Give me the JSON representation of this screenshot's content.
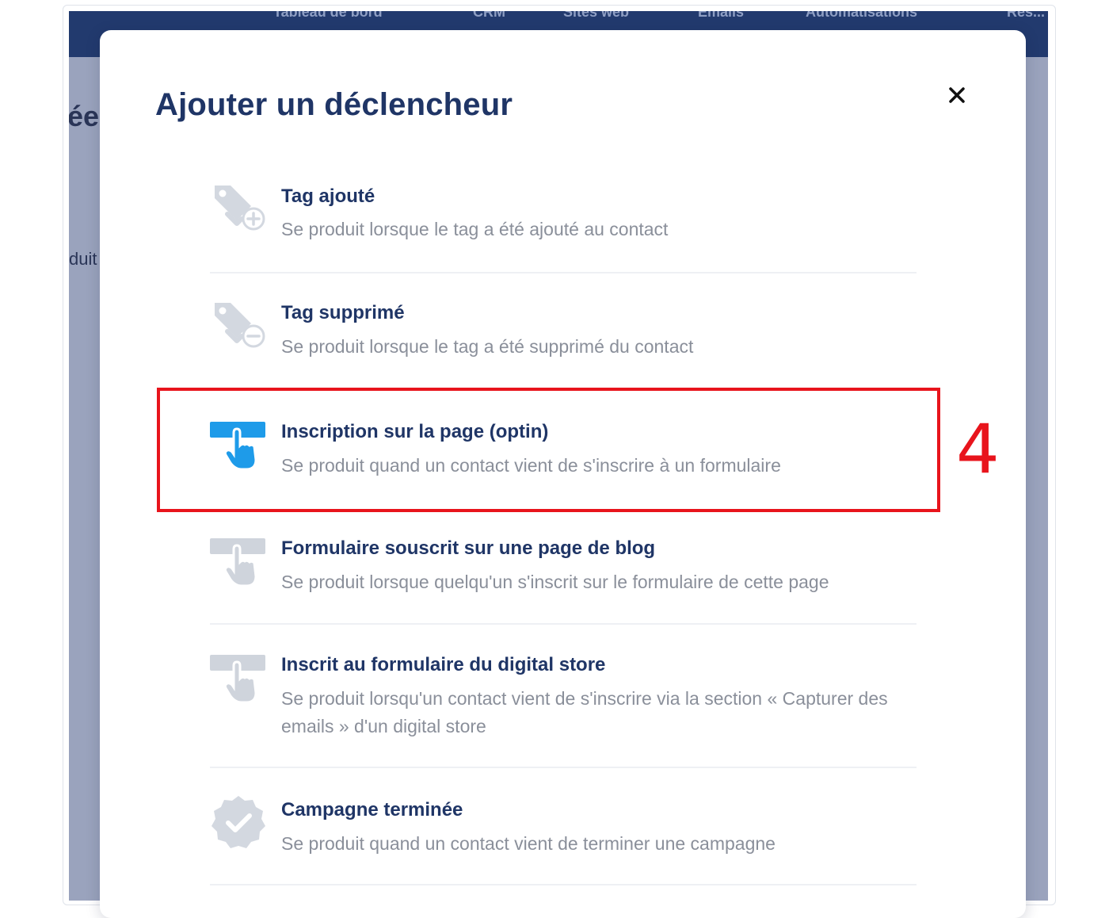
{
  "background_app": {
    "nav_items": [
      "Tableau de bord",
      "CRM",
      "Sites web",
      "Emails",
      "Automatisations",
      "Res..."
    ],
    "peek_heading": "ée",
    "peek_text": "duit"
  },
  "modal": {
    "title": "Ajouter un déclencheur",
    "close_label": "×",
    "triggers": [
      {
        "title": "Tag ajouté",
        "description": "Se produit lorsque le tag a été ajouté au contact",
        "icon": "tag-add-icon",
        "active": false
      },
      {
        "title": "Tag supprimé",
        "description": "Se produit lorsque le tag a été supprimé du contact",
        "icon": "tag-remove-icon",
        "active": false
      },
      {
        "title": "Inscription sur la page (optin)",
        "description": "Se produit quand un contact vient de s'inscrire à un formulaire",
        "icon": "form-click-icon",
        "active": true
      },
      {
        "title": "Formulaire souscrit sur une page de blog",
        "description": "Se produit lorsque quelqu'un s'inscrit sur le formulaire de cette page",
        "icon": "form-click-icon",
        "active": false
      },
      {
        "title": "Inscrit au formulaire du digital store",
        "description": "Se produit lorsqu'un contact vient de s'inscrire via la section « Capturer des emails » d'un digital store",
        "icon": "form-click-icon",
        "active": false
      },
      {
        "title": "Campagne terminée",
        "description": "Se produit quand un contact vient de terminer une campagne",
        "icon": "check-badge-icon",
        "active": false
      }
    ]
  },
  "annotation": {
    "step_number": "4",
    "color": "#e8141c"
  },
  "colors": {
    "title": "#1f3566",
    "description": "#8a8f9a",
    "active_icon": "#1e9be9",
    "inactive_icon": "#cfd4dc",
    "nav_bg": "#223a6e",
    "overlay": "#9aa3bd"
  }
}
